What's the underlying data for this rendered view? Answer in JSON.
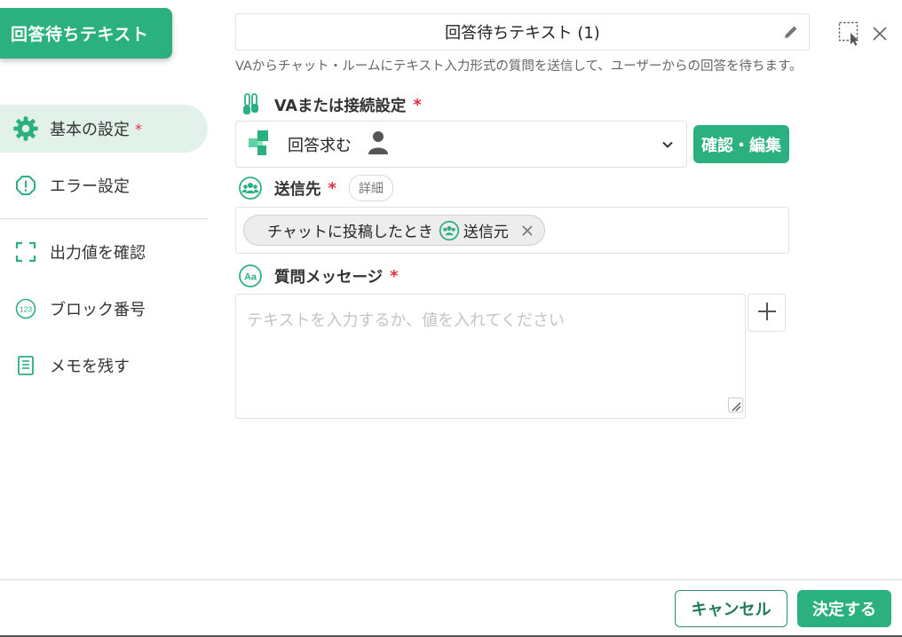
{
  "block_tab": {
    "label": "回答待ちテキスト"
  },
  "sidebar": {
    "items": [
      {
        "label": "基本の設定",
        "required": "*",
        "icon": "gear-icon"
      },
      {
        "label": "エラー設定",
        "icon": "alert-circle-icon"
      },
      {
        "label": "出力値を確認",
        "icon": "frame-corners-icon"
      },
      {
        "label": "ブロック番号",
        "icon": "number-123-icon"
      },
      {
        "label": "メモを残す",
        "icon": "memo-icon"
      }
    ]
  },
  "header": {
    "title": "回答待ちテキスト (1)",
    "description": "VAからチャット・ルームにテキスト入力形式の質問を送信して、ユーザーからの回答を待ちます。"
  },
  "va_section": {
    "label": "VAまたは接続設定",
    "required": "*",
    "selected_name": "回答求む",
    "confirm_button": "確認・編集"
  },
  "destination": {
    "label": "送信先",
    "required": "*",
    "detail_chip": "詳細",
    "chip_text": "チャットに投稿したとき",
    "chip_sub": "送信元"
  },
  "message": {
    "label": "質問メッセージ",
    "required": "*",
    "placeholder": "テキストを入力するか、値を入れてください"
  },
  "footer": {
    "cancel": "キャンセル",
    "ok": "決定する"
  },
  "colors": {
    "accent": "#2bb07f",
    "required": "#e0303c",
    "active_bg": "#e3f1eb"
  }
}
